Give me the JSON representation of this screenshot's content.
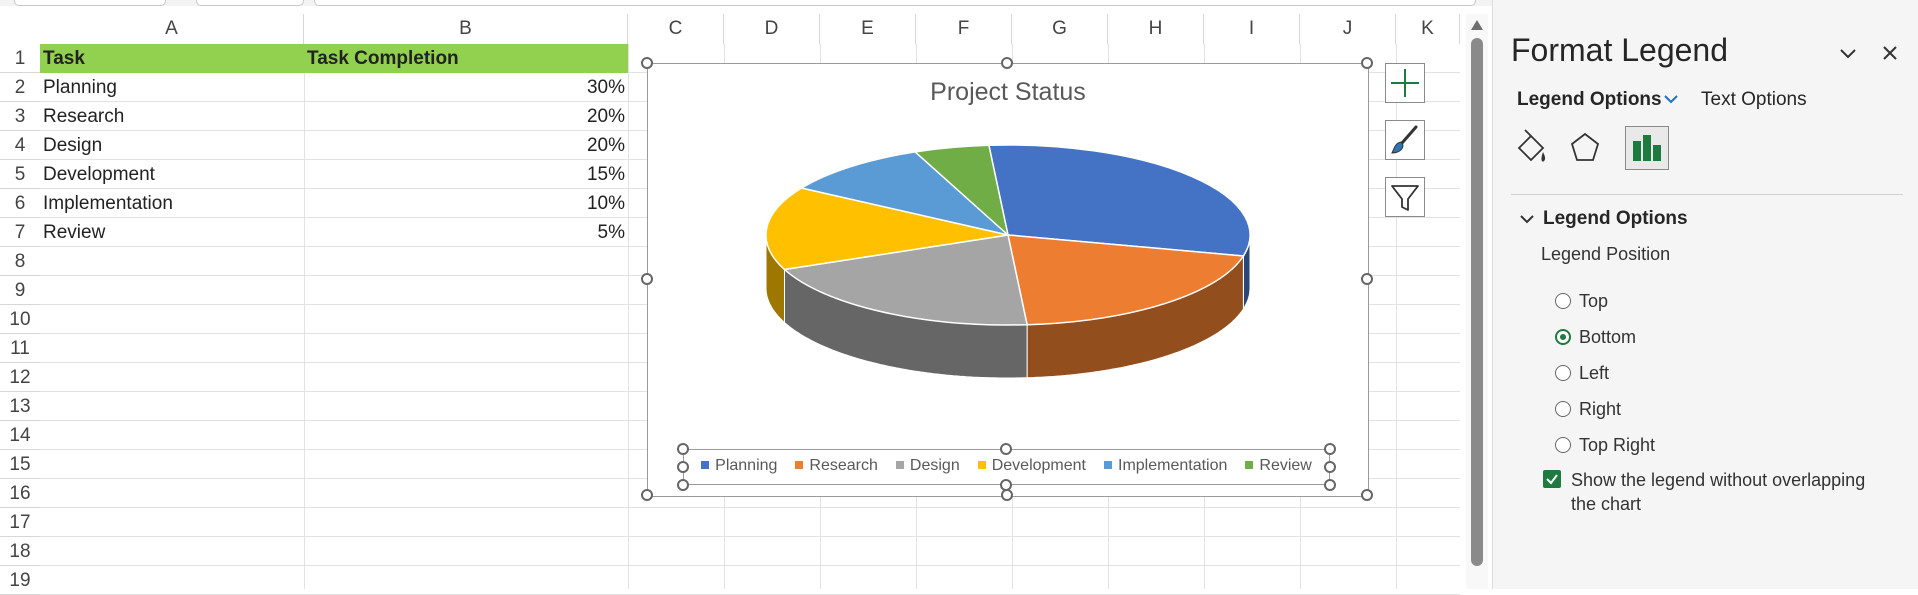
{
  "sheet": {
    "columns": [
      "A",
      "B",
      "C",
      "D",
      "E",
      "F",
      "G",
      "H",
      "I",
      "J",
      "K"
    ],
    "rows": [
      "1",
      "2",
      "3",
      "4",
      "5",
      "6",
      "7",
      "8",
      "9",
      "10",
      "11",
      "12",
      "13",
      "14",
      "15",
      "16",
      "17",
      "18",
      "19"
    ],
    "header": {
      "task": "Task",
      "completion": "Task Completion"
    },
    "data": [
      {
        "task": "Planning",
        "completion": "30%"
      },
      {
        "task": "Research",
        "completion": "20%"
      },
      {
        "task": "Design",
        "completion": "20%"
      },
      {
        "task": "Development",
        "completion": "15%"
      },
      {
        "task": "Implementation",
        "completion": "10%"
      },
      {
        "task": "Review",
        "completion": "5%"
      }
    ]
  },
  "chart": {
    "title": "Project Status",
    "legend": [
      "Planning",
      "Research",
      "Design",
      "Development",
      "Implementation",
      "Review"
    ]
  },
  "chart_data": {
    "type": "pie",
    "title": "Project Status",
    "categories": [
      "Planning",
      "Research",
      "Design",
      "Development",
      "Implementation",
      "Review"
    ],
    "values": [
      30,
      20,
      20,
      15,
      10,
      5
    ],
    "colors": [
      "#4472c4",
      "#ed7d31",
      "#a5a5a5",
      "#ffc000",
      "#5b9bd5",
      "#70ad47"
    ],
    "legend_position": "bottom",
    "style": "3d"
  },
  "chart_buttons": [
    "plus-icon",
    "brush-icon",
    "filter-icon"
  ],
  "panel": {
    "title": "Format Legend",
    "tab_legend_options": "Legend Options",
    "tab_text_options": "Text Options",
    "section_title": "Legend Options",
    "position_label": "Legend Position",
    "positions": [
      {
        "label": "Top",
        "checked": false
      },
      {
        "label": "Bottom",
        "checked": true
      },
      {
        "label": "Left",
        "checked": false
      },
      {
        "label": "Right",
        "checked": false
      },
      {
        "label": "Top Right",
        "checked": false
      }
    ],
    "overlap_checkbox": "Show the legend without overlapping the chart",
    "overlap_checked": true
  }
}
